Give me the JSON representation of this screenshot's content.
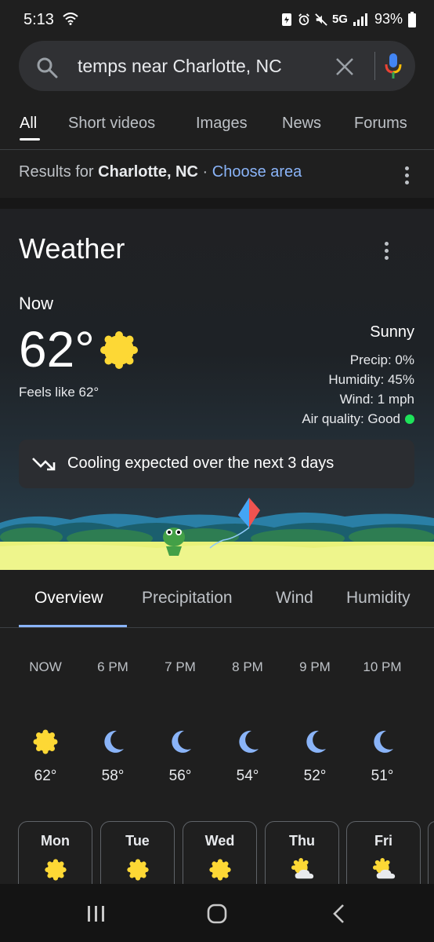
{
  "status": {
    "time": "5:13",
    "network": "5G",
    "battery": "93%"
  },
  "search": {
    "query": "temps near Charlotte, NC"
  },
  "tabs": [
    "All",
    "Short videos",
    "Images",
    "News",
    "Forums"
  ],
  "results": {
    "prefix": "Results for",
    "location": "Charlotte, NC",
    "separator": "·",
    "choose_area": "Choose area"
  },
  "weather": {
    "title": "Weather",
    "now_label": "Now",
    "temp": "62°",
    "feels_like": "Feels like 62°",
    "condition": "Sunny",
    "precip": "Precip: 0%",
    "humidity": "Humidity: 45%",
    "wind": "Wind: 1 mph",
    "air_quality": "Air quality: Good",
    "air_quality_color": "#1ee35a",
    "banner": "Cooling expected over the next 3 days"
  },
  "forecast_tabs": [
    "Overview",
    "Precipitation",
    "Wind",
    "Humidity"
  ],
  "hourly": [
    {
      "time": "NOW",
      "temp": "62°",
      "icon": "sun-icon"
    },
    {
      "time": "6 PM",
      "temp": "58°",
      "icon": "moon-icon"
    },
    {
      "time": "7 PM",
      "temp": "56°",
      "icon": "moon-icon"
    },
    {
      "time": "8 PM",
      "temp": "54°",
      "icon": "moon-icon"
    },
    {
      "time": "9 PM",
      "temp": "52°",
      "icon": "moon-icon"
    },
    {
      "time": "10 PM",
      "temp": "51°",
      "icon": "moon-icon"
    }
  ],
  "daily": [
    {
      "day": "Mon",
      "icon": "sun-icon"
    },
    {
      "day": "Tue",
      "icon": "sun-icon"
    },
    {
      "day": "Wed",
      "icon": "sun-icon"
    },
    {
      "day": "Thu",
      "icon": "partly-cloudy-icon"
    },
    {
      "day": "Fri",
      "icon": "partly-cloudy-icon"
    }
  ],
  "colors": {
    "accent": "#8ab4f8",
    "sun": "#fdd835",
    "moon": "#8ab4f8"
  }
}
